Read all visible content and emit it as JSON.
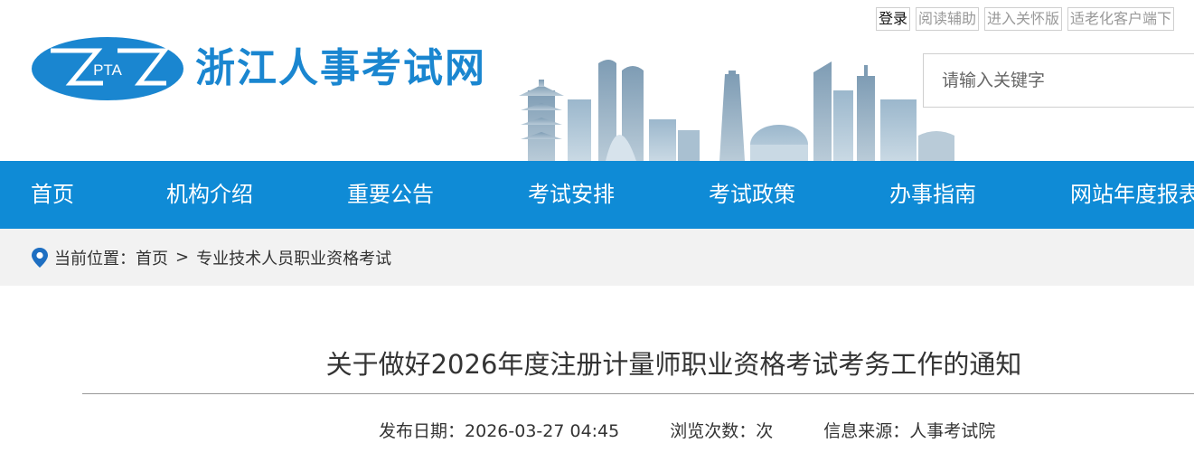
{
  "header": {
    "logo_text": "PTA",
    "site_title": "浙江人事考试网",
    "top_links": [
      {
        "label": "登录"
      },
      {
        "label": "阅读辅助"
      },
      {
        "label": "进入关怀版"
      },
      {
        "label": "适老化客户端下"
      }
    ],
    "search": {
      "placeholder": "请输入关键字",
      "value": ""
    }
  },
  "nav": {
    "items": [
      {
        "label": "首页"
      },
      {
        "label": "机构介绍"
      },
      {
        "label": "重要公告"
      },
      {
        "label": "考试安排"
      },
      {
        "label": "考试政策"
      },
      {
        "label": "办事指南"
      },
      {
        "label": "网站年度报表"
      }
    ]
  },
  "breadcrumb": {
    "prefix": "当前位置：",
    "home": "首页",
    "separator": ">",
    "current": "专业技术人员职业资格考试"
  },
  "article": {
    "title": "关于做好2026年度注册计量师职业资格考试考务工作的通知",
    "publish_label": "发布日期：",
    "publish_date": "2026-03-27 04:45",
    "views_label": "浏览次数：",
    "views_suffix": "次",
    "source_label": "信息来源：",
    "source": "人事考试院"
  },
  "colors": {
    "brand_blue": "#1a86d0",
    "nav_bg": "#0f8bd6",
    "crumb_bg": "#f2f2f2"
  }
}
